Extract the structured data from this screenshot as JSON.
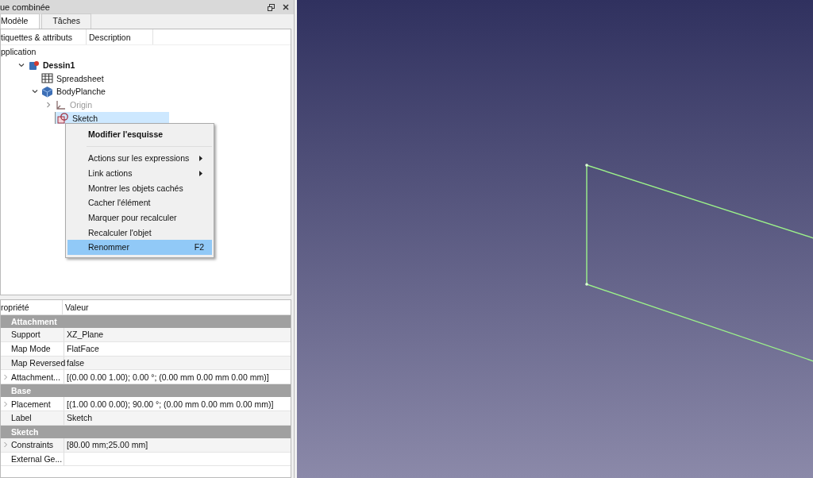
{
  "panel": {
    "title": "ue combinée"
  },
  "tabs": [
    {
      "label": "Modèle",
      "selected": true
    },
    {
      "label": "Tâches",
      "selected": false
    }
  ],
  "tree": {
    "columns": [
      "tiquettes & attributs",
      "Description"
    ],
    "items": [
      {
        "label": "pplication",
        "children": [
          {
            "label": "Dessin1",
            "kind": "document",
            "bold": true,
            "expanded": true,
            "children": [
              {
                "label": "Spreadsheet",
                "kind": "spreadsheet"
              },
              {
                "label": "BodyPlanche",
                "kind": "body",
                "expanded": true,
                "children": [
                  {
                    "label": "Origin",
                    "kind": "origin",
                    "expanded": false,
                    "hidden": true
                  },
                  {
                    "label": "Sketch",
                    "kind": "sketch",
                    "selected": true
                  }
                ]
              }
            ]
          }
        ]
      }
    ]
  },
  "context_menu": [
    {
      "kind": "item",
      "label": "Modifier l'esquisse",
      "bold": true,
      "selected": false
    },
    {
      "kind": "separator"
    },
    {
      "kind": "item",
      "label": "Actions sur les expressions",
      "submenu": true,
      "selected": false
    },
    {
      "kind": "item",
      "label": "Link actions",
      "submenu": true,
      "selected": false
    },
    {
      "kind": "item",
      "label": "Montrer les objets cachés",
      "selected": false
    },
    {
      "kind": "item",
      "label": "Cacher l'élément",
      "selected": false
    },
    {
      "kind": "item",
      "label": "Marquer pour recalculer",
      "selected": false
    },
    {
      "kind": "item",
      "label": "Recalculer l'objet",
      "selected": false
    },
    {
      "kind": "item",
      "label": "Renommer",
      "shortcut": "F2",
      "selected": true
    }
  ],
  "properties": {
    "columns": [
      "ropriété",
      "Valeur"
    ],
    "groups": [
      {
        "name": "Attachment",
        "rows": [
          {
            "name": "Support",
            "value": "XZ_Plane",
            "expandable": false
          },
          {
            "name": "Map Mode",
            "value": "FlatFace",
            "expandable": false
          },
          {
            "name": "Map Reversed",
            "value": "false",
            "expandable": false
          },
          {
            "name": "Attachment...",
            "value": "[(0.00 0.00 1.00); 0.00 °; (0.00 mm  0.00 mm  0.00 mm)]",
            "expandable": true
          }
        ]
      },
      {
        "name": "Base",
        "rows": [
          {
            "name": "Placement",
            "value": "[(1.00 0.00 0.00); 90.00 °; (0.00 mm  0.00 mm  0.00 mm)]",
            "expandable": true
          },
          {
            "name": "Label",
            "value": "Sketch",
            "expandable": false
          }
        ]
      },
      {
        "name": "Sketch",
        "rows": [
          {
            "name": "Constraints",
            "value": "[80.00 mm;25.00 mm]",
            "expandable": true
          },
          {
            "name": "External Ge...",
            "expandable": false
          }
        ]
      }
    ]
  }
}
